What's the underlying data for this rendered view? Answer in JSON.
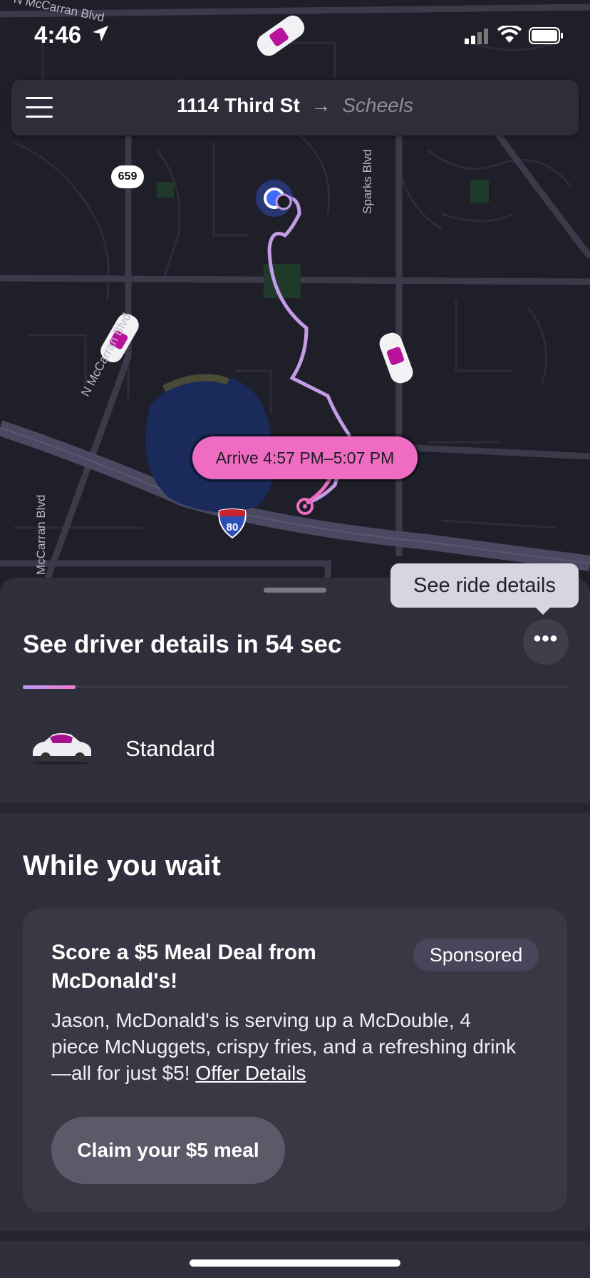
{
  "status_bar": {
    "time": "4:46"
  },
  "route": {
    "origin": "1114 Third St",
    "destination": "Scheels"
  },
  "map": {
    "labels": {
      "n_mccarran_top": "N McCarran Blvd",
      "sparks_blvd": "Sparks Blvd",
      "n_mccarran_mid": "N McCarran Blvd",
      "mccarran_left": "McCarran Blvd"
    },
    "highway_659": "659",
    "interstate_80": "80",
    "eta_label": "Arrive 4:57 PM–5:07 PM"
  },
  "tooltip": {
    "text": "See ride details"
  },
  "sheet": {
    "driver_title": "See driver details in 54 sec",
    "more_icon": "•••",
    "ride_type": "Standard",
    "while_you_wait": "While you wait"
  },
  "promo": {
    "title": "Score a $5 Meal Deal from McDonald's!",
    "sponsored": "Sponsored",
    "body": "Jason, McDonald's is serving up a McDouble, 4 piece McNuggets, crispy fries, and a refreshing drink—all for just $5!",
    "link": "Offer Details",
    "button": "Claim your $5 meal"
  },
  "colors": {
    "accent_pink": "#ef6cc2",
    "route_purple": "#c49be6",
    "map_background": "#1d1d26",
    "sheet_background": "#2f2f3b"
  }
}
